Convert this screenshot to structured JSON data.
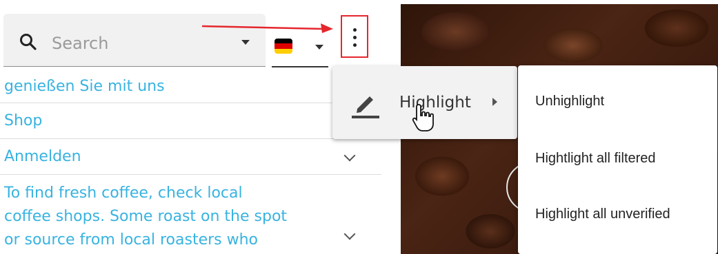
{
  "search": {
    "placeholder": "Search",
    "icon": "search-icon"
  },
  "language": {
    "flag": "germany-flag",
    "flag_colors": [
      "#000000",
      "#dd0000",
      "#ffce00"
    ]
  },
  "more_button": {
    "icon": "more-vertical-icon",
    "highlight_color": "#e5262d"
  },
  "list": {
    "items": [
      {
        "text": "genießen Sie mit uns"
      },
      {
        "text": "Shop"
      },
      {
        "text": "Anmelden"
      },
      {
        "text_lines": [
          "To find fresh coffee, check local",
          "coffee shops. Some roast on the spot",
          "or source from local roasters who"
        ]
      }
    ],
    "accent_color": "#38b3e0"
  },
  "menu": {
    "item_label": "Highlight",
    "item_icon": "pencil-icon"
  },
  "submenu": {
    "items": [
      "Unhighlight",
      "Hightlight all filtered",
      "Highlight all unverified"
    ]
  }
}
